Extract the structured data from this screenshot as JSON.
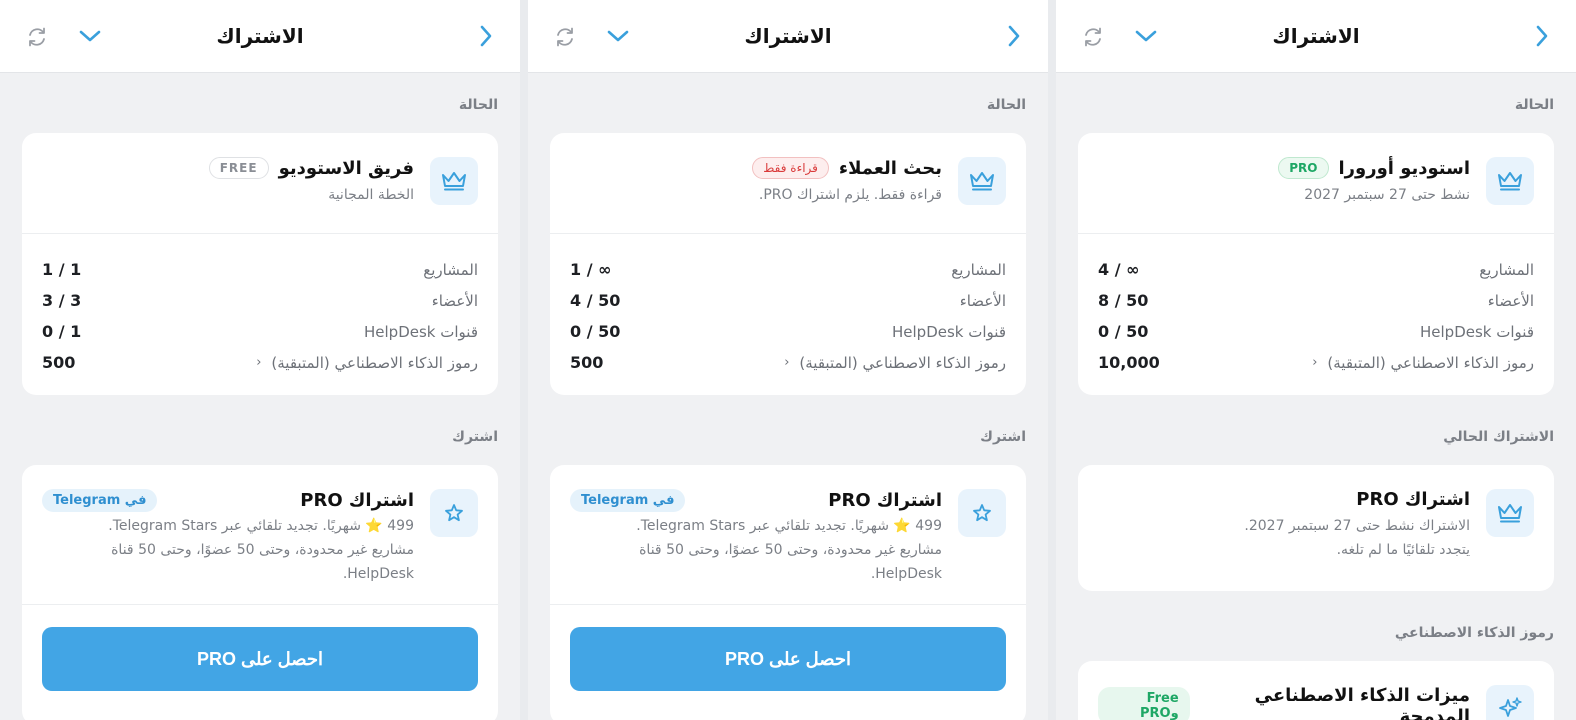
{
  "panels": [
    {
      "header": {
        "title": "الاشتراك"
      },
      "status_label": "الحالة",
      "workspace": {
        "name": "استوديو أورورا",
        "badge": "PRO",
        "subtitle": "نشط حتى 27 سبتمبر 2027"
      },
      "limits": [
        {
          "label": "المشاريع",
          "value": "4 / ∞"
        },
        {
          "label": "الأعضاء",
          "value": "8 / 50"
        },
        {
          "label": "قنوات HelpDesk",
          "value": "0 / 50"
        },
        {
          "label": "رموز الذكاء الاصطناعي (المتبقية)",
          "value": "10,000"
        }
      ],
      "current_section": "الاشتراك الحالي",
      "current": {
        "title": "اشتراك PRO",
        "line1": "الاشتراك نشط حتى 27 سبتمبر 2027.",
        "line2": "يتجدد تلقائيًا ما لم تلغه."
      },
      "ai_section": "رموز الذكاء الاصطناعي",
      "ai": {
        "title": "ميزات الذكاء الاصطناعي المدمجة",
        "badge": "Free وPRO"
      }
    },
    {
      "header": {
        "title": "الاشتراك"
      },
      "status_label": "الحالة",
      "workspace": {
        "name": "بحث العملاء",
        "badge": "قراءة فقط",
        "subtitle": "قراءة فقط. يلزم اشتراك PRO."
      },
      "limits": [
        {
          "label": "المشاريع",
          "value": "1 / ∞"
        },
        {
          "label": "الأعضاء",
          "value": "4 / 50"
        },
        {
          "label": "قنوات HelpDesk",
          "value": "0 / 50"
        },
        {
          "label": "رموز الذكاء الاصطناعي (المتبقية)",
          "value": "500"
        }
      ],
      "subscribe_section": "اشترك",
      "offer": {
        "title": "اشتراك PRO",
        "badge": "في Telegram",
        "line1": "499 ⭐ شهريًا. تجديد تلقائي عبر Telegram Stars.",
        "line2": "مشاريع غير محدودة، وحتى 50 عضوًا، وحتى 50 قناة",
        "line3": "HelpDesk."
      },
      "cta": "احصل على PRO"
    },
    {
      "header": {
        "title": "الاشتراك"
      },
      "status_label": "الحالة",
      "workspace": {
        "name": "فريق الاستوديو",
        "badge": "FREE",
        "subtitle": "الخطة المجانية"
      },
      "limits": [
        {
          "label": "المشاريع",
          "value": "1 / 1"
        },
        {
          "label": "الأعضاء",
          "value": "3 / 3"
        },
        {
          "label": "قنوات HelpDesk",
          "value": "0 / 1"
        },
        {
          "label": "رموز الذكاء الاصطناعي (المتبقية)",
          "value": "500"
        }
      ],
      "subscribe_section": "اشترك",
      "offer": {
        "title": "اشتراك PRO",
        "badge": "في Telegram",
        "line1": "499 ⭐ شهريًا. تجديد تلقائي عبر Telegram Stars.",
        "line2": "مشاريع غير محدودة، وحتى 50 عضوًا، وحتى 50 قناة",
        "line3": "HelpDesk."
      },
      "cta": "احصل على PRO"
    }
  ],
  "colors": {
    "accent": "#42a5e5",
    "icon": "#3aa0dc",
    "pro_green": "#1ea765",
    "readonly_red": "#d93a3a"
  },
  "icons": {
    "back": "chevron-right-icon",
    "collapse": "chevron-down-icon",
    "refresh": "refresh-icon",
    "plan": "crown-icon",
    "offer": "star-icon",
    "ai": "sparkle-icon"
  }
}
